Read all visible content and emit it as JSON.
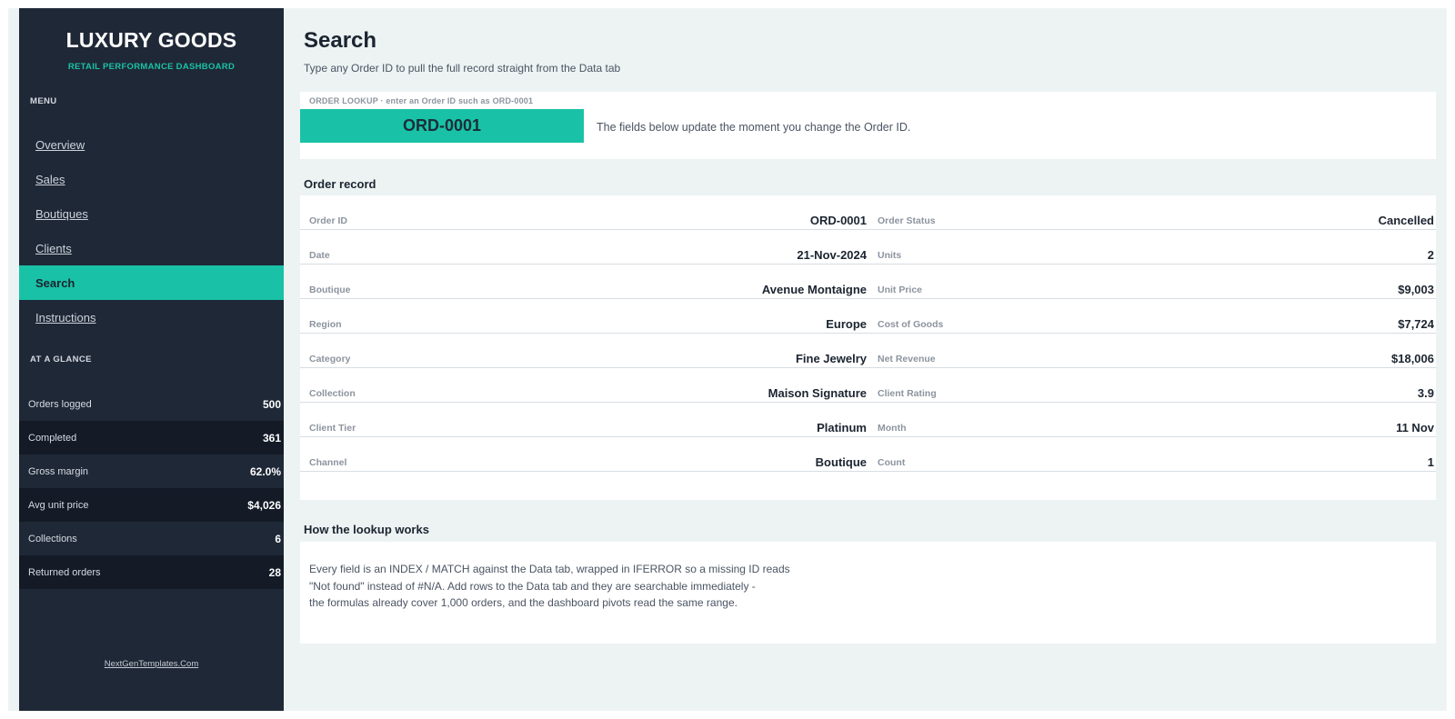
{
  "sidebar": {
    "brand_title": "LUXURY GOODS",
    "brand_subtitle": "RETAIL PERFORMANCE DASHBOARD",
    "menu_label": "MENU",
    "nav": [
      {
        "label": "Overview",
        "active": false
      },
      {
        "label": "Sales",
        "active": false
      },
      {
        "label": "Boutiques",
        "active": false
      },
      {
        "label": "Clients",
        "active": false
      },
      {
        "label": "Search",
        "active": true
      },
      {
        "label": "Instructions",
        "active": false
      }
    ],
    "glance_label": "AT A GLANCE",
    "stats": [
      {
        "label": "Orders logged",
        "value": "500"
      },
      {
        "label": "Completed",
        "value": "361"
      },
      {
        "label": "Gross margin",
        "value": "62.0%"
      },
      {
        "label": "Avg unit price",
        "value": "$4,026"
      },
      {
        "label": "Collections",
        "value": "6"
      },
      {
        "label": "Returned orders",
        "value": "28"
      }
    ],
    "footer_link": "NextGenTemplates.Com"
  },
  "main": {
    "title": "Search",
    "subtitle": "Type any Order ID to pull the full record straight from the Data tab",
    "lookup": {
      "label": "ORDER LOOKUP  ·  enter an Order ID such as ORD-0001",
      "value": "ORD-0001",
      "hint": "The fields below update the moment you change the Order ID."
    },
    "record_heading": "Order record",
    "record_left": [
      {
        "label": "Order ID",
        "value": "ORD-0001"
      },
      {
        "label": "Date",
        "value": "21-Nov-2024"
      },
      {
        "label": "Boutique",
        "value": "Avenue Montaigne"
      },
      {
        "label": "Region",
        "value": "Europe"
      },
      {
        "label": "Category",
        "value": "Fine Jewelry"
      },
      {
        "label": "Collection",
        "value": "Maison Signature"
      },
      {
        "label": "Client Tier",
        "value": "Platinum"
      },
      {
        "label": "Channel",
        "value": "Boutique"
      }
    ],
    "record_right": [
      {
        "label": "Order Status",
        "value": "Cancelled"
      },
      {
        "label": "Units",
        "value": "2"
      },
      {
        "label": "Unit Price",
        "value": "$9,003"
      },
      {
        "label": "Cost of Goods",
        "value": "$7,724"
      },
      {
        "label": "Net Revenue",
        "value": "$18,006"
      },
      {
        "label": "Client Rating",
        "value": "3.9"
      },
      {
        "label": "Month",
        "value": "11 Nov"
      },
      {
        "label": "Count",
        "value": "1"
      }
    ],
    "how_heading": "How the lookup works",
    "how_lines": [
      "Every field is an INDEX / MATCH against the Data tab, wrapped in IFERROR so a missing ID reads",
      "\"Not found\" instead of #N/A. Add rows to the Data tab and they are searchable immediately -",
      "the formulas already cover 1,000 orders, and the dashboard pivots read the same range."
    ]
  },
  "colors": {
    "sidebar_bg": "#1f2837",
    "accent": "#19c2a6",
    "page_bg": "#edf3f3"
  }
}
